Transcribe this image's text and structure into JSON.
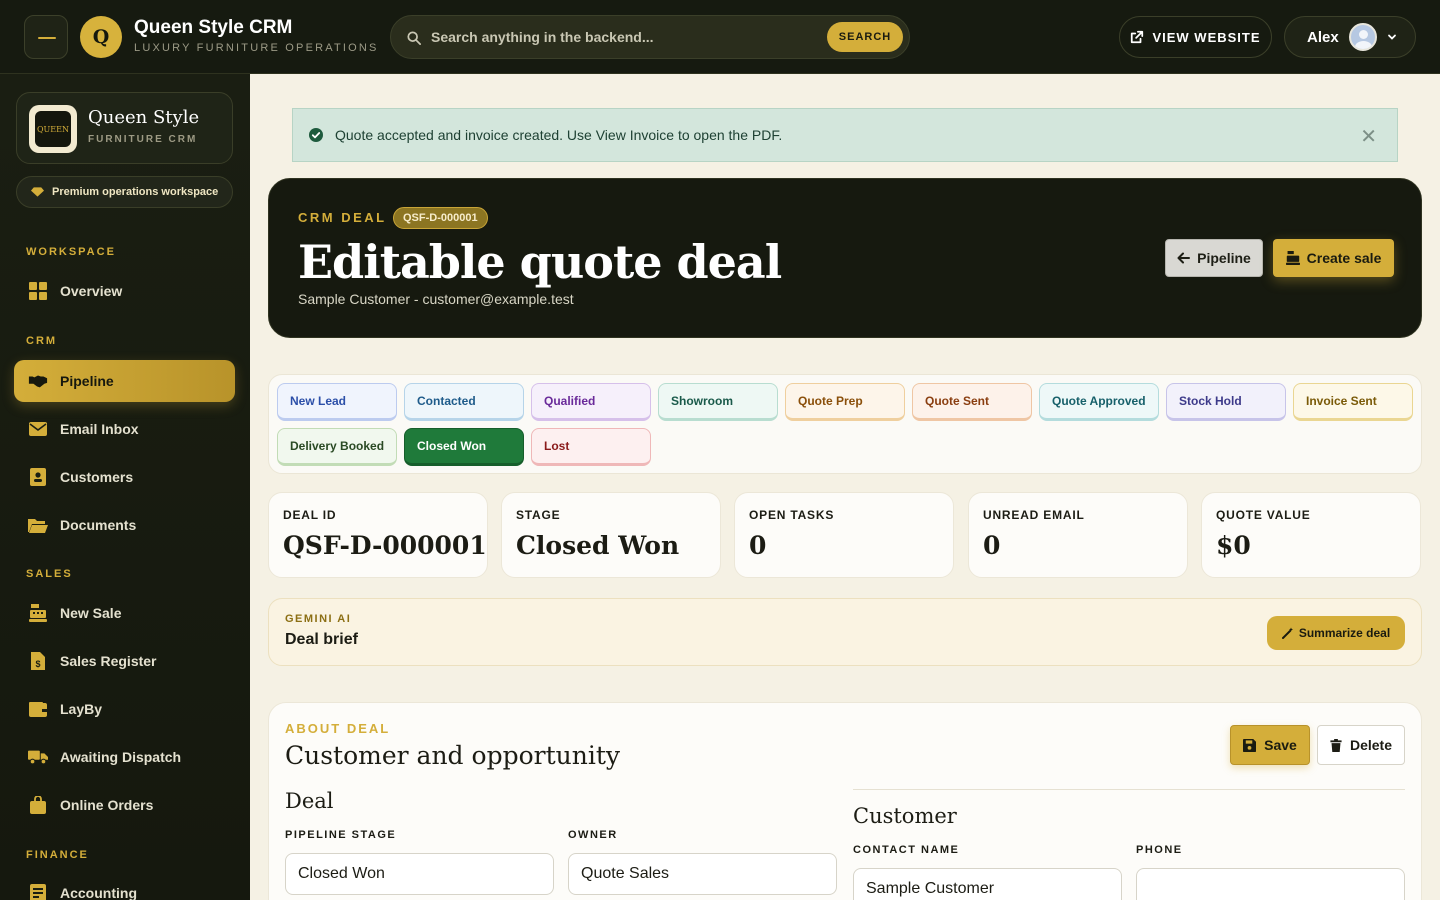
{
  "topbar": {
    "logo_letter": "Q",
    "brand_title": "Queen Style CRM",
    "brand_subtitle": "LUXURY FURNITURE OPERATIONS",
    "search_placeholder": "Search anything in the backend...",
    "search_button": "SEARCH",
    "view_website": "VIEW WEBSITE",
    "user_name": "Alex"
  },
  "sidebar": {
    "brand_title": "Queen Style",
    "brand_subtitle": "FURNITURE CRM",
    "logo_text": "QUEEN",
    "premium_label": "Premium operations workspace",
    "sections": {
      "workspace": "WORKSPACE",
      "crm": "CRM",
      "sales": "SALES",
      "finance": "FINANCE"
    },
    "items": {
      "overview": "Overview",
      "pipeline": "Pipeline",
      "email_inbox": "Email Inbox",
      "customers": "Customers",
      "documents": "Documents",
      "new_sale": "New Sale",
      "sales_register": "Sales Register",
      "layby": "LayBy",
      "awaiting_dispatch": "Awaiting Dispatch",
      "online_orders": "Online Orders",
      "accounting": "Accounting"
    }
  },
  "alert": {
    "message": "Quote accepted and invoice created. Use View Invoice to open the PDF.",
    "close": "✕"
  },
  "hero": {
    "kicker": "CRM DEAL",
    "badge": "QSF-D-000001",
    "title": "Editable quote deal",
    "subtitle": "Sample Customer - customer@example.test",
    "pipeline_button": "Pipeline",
    "create_sale_button": "Create sale"
  },
  "stages": [
    {
      "label": "New Lead",
      "color": "#2c4fa8",
      "bg": "#f0f4fd",
      "border": "#bccbef"
    },
    {
      "label": "Contacted",
      "color": "#1e5b8a",
      "bg": "#eef6fb",
      "border": "#b6d4e9"
    },
    {
      "label": "Qualified",
      "color": "#6a2a9a",
      "bg": "#f6f0fb",
      "border": "#d6c0ea"
    },
    {
      "label": "Showroom",
      "color": "#1a5a4a",
      "bg": "#eef8f4",
      "border": "#b8ddd0"
    },
    {
      "label": "Quote Prep",
      "color": "#8a4f0a",
      "bg": "#fdf5ea",
      "border": "#efcf9e"
    },
    {
      "label": "Quote Sent",
      "color": "#8a3e10",
      "bg": "#fdf2ea",
      "border": "#efc6a4"
    },
    {
      "label": "Quote Approved",
      "color": "#17606a",
      "bg": "#eef8f8",
      "border": "#b4dcdd"
    },
    {
      "label": "Stock Hold",
      "color": "#3d3a8a",
      "bg": "#f2f1fb",
      "border": "#c7c4e9"
    },
    {
      "label": "Invoice Sent",
      "color": "#7a5a08",
      "bg": "#fdf8e8",
      "border": "#ead692"
    },
    {
      "label": "Delivery Booked",
      "color": "#2a4a24",
      "bg": "#f1f8ee",
      "border": "#c2dcb6"
    },
    {
      "label": "Closed Won",
      "color": "#ffffff",
      "bg": "#1f7a3a",
      "border": "#165e2b"
    },
    {
      "label": "Lost",
      "color": "#8a1a1a",
      "bg": "#fdf0f0",
      "border": "#efb8b8"
    }
  ],
  "stats": [
    {
      "label": "DEAL ID",
      "value": "QSF-D-000001"
    },
    {
      "label": "STAGE",
      "value": "Closed Won"
    },
    {
      "label": "OPEN TASKS",
      "value": "0"
    },
    {
      "label": "UNREAD EMAIL",
      "value": "0"
    },
    {
      "label": "QUOTE VALUE",
      "value": "$0"
    }
  ],
  "ai": {
    "kicker": "GEMINI AI",
    "title": "Deal brief",
    "button": "Summarize deal"
  },
  "about": {
    "kicker": "ABOUT DEAL",
    "title": "Customer and opportunity",
    "save": "Save",
    "delete": "Delete",
    "deal_heading": "Deal",
    "customer_heading": "Customer",
    "pipeline_stage_label": "PIPELINE STAGE",
    "pipeline_stage_value": "Closed Won",
    "owner_label": "OWNER",
    "owner_value": "Quote Sales",
    "contact_name_label": "CONTACT NAME",
    "contact_name_value": "Sample Customer",
    "phone_label": "PHONE",
    "phone_value": ""
  }
}
